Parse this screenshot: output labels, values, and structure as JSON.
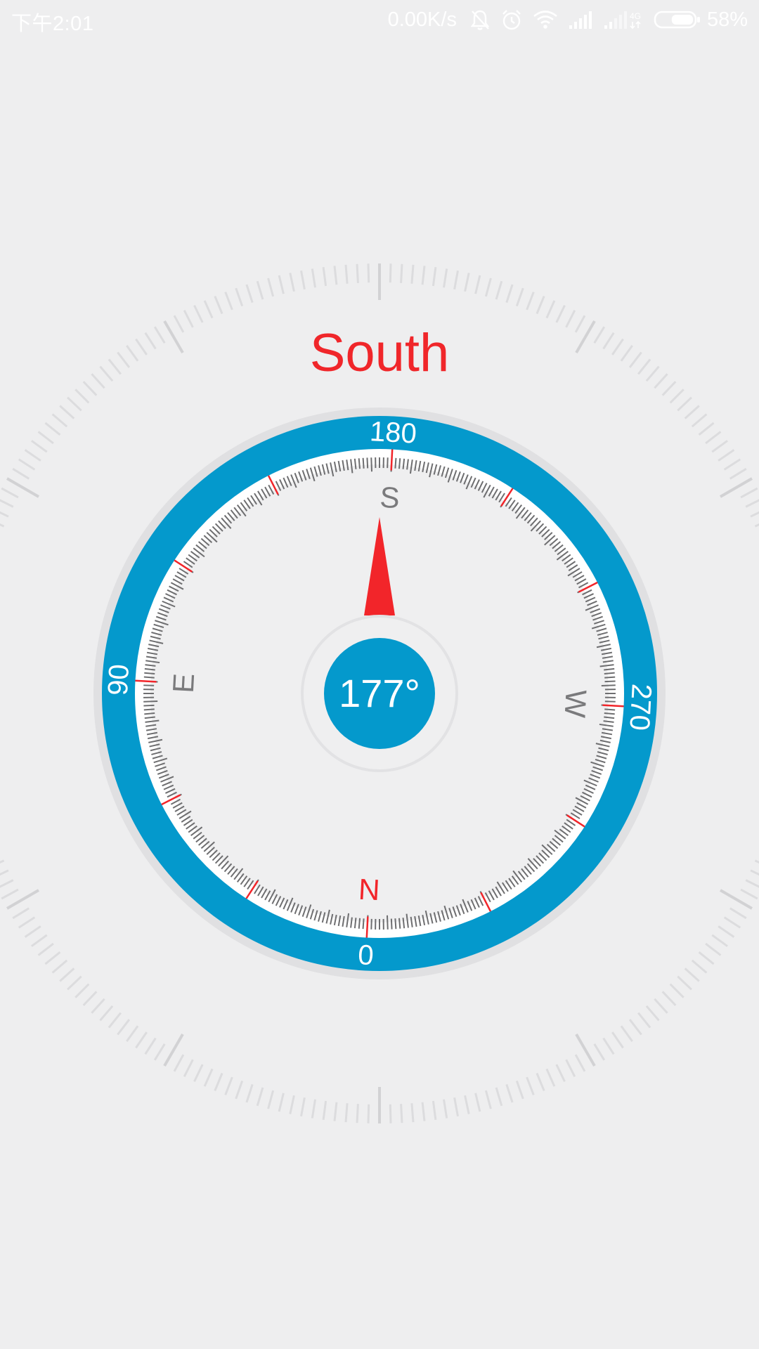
{
  "status_bar": {
    "time": "下午2:01",
    "net_speed": "0.00K/s",
    "network_type": "4G",
    "battery_percent": "58%",
    "battery_level": 0.58,
    "icons": [
      "bell-off-icon",
      "alarm-clock-icon",
      "wifi-icon",
      "cell-signal-icon",
      "cell-signal-2-icon",
      "battery-icon"
    ]
  },
  "compass": {
    "direction_label": "South",
    "heading_degrees": 177,
    "heading_text": "177°",
    "degree_labels": {
      "d0": "0",
      "d90": "90",
      "d180": "180",
      "d270": "270"
    },
    "cardinal_labels": {
      "north": "N",
      "east": "E",
      "south": "S",
      "west": "W"
    },
    "colors": {
      "ring_blue": "#0499cc",
      "accent_red": "#f2252a",
      "background": "#eeeeef",
      "tick_gray": "#6e6e70"
    }
  }
}
